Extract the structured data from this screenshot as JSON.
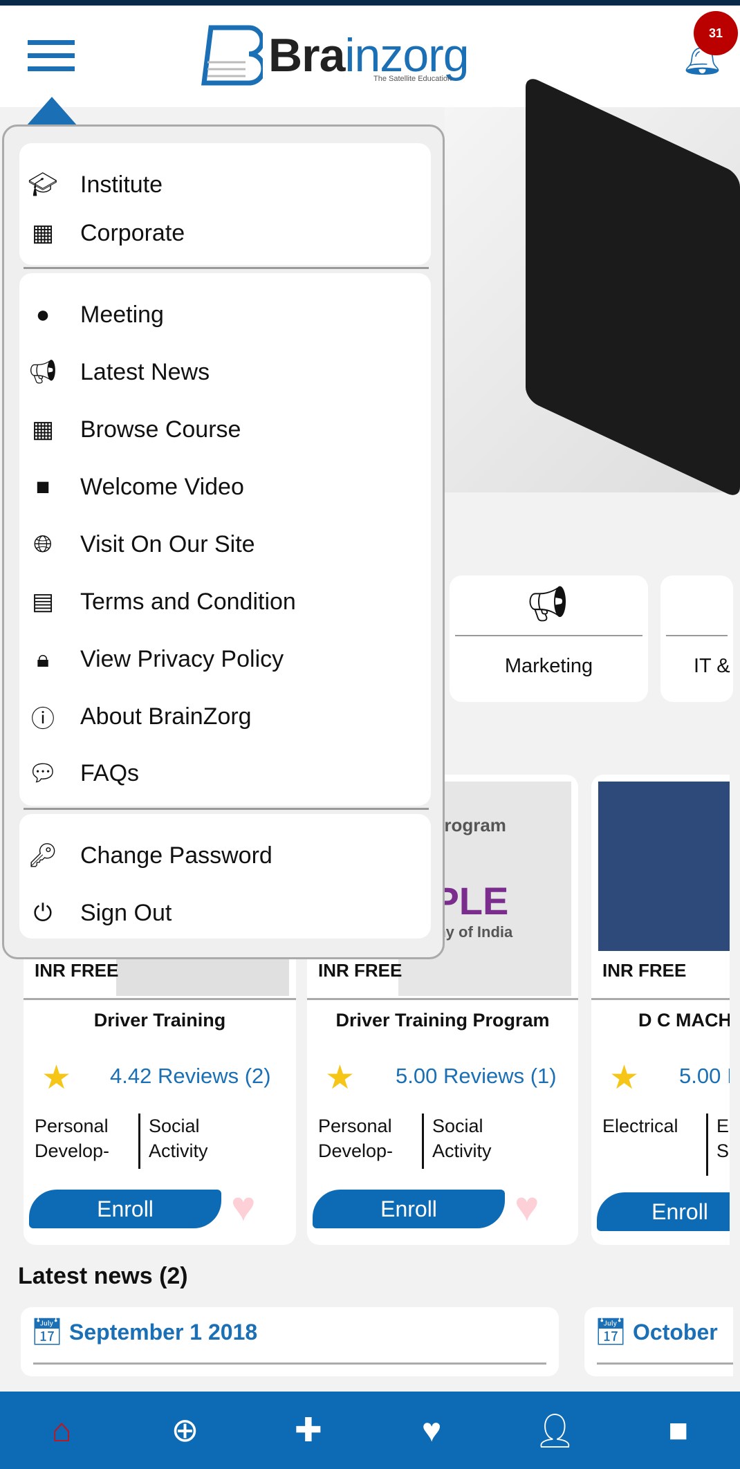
{
  "header": {
    "logo_text_a": "Bra",
    "logo_text_b": "i",
    "logo_text_c": "nzorg",
    "logo_tagline": "The Satellite Education",
    "notification_count": "31"
  },
  "menu": {
    "group1": [
      {
        "label": "Institute",
        "icon": "graduation-cap-icon"
      },
      {
        "label": "Corporate",
        "icon": "building-icon"
      }
    ],
    "group2": [
      {
        "label": "Meeting",
        "icon": "user-icon"
      },
      {
        "label": "Latest News",
        "icon": "megaphone-icon"
      },
      {
        "label": "Browse Course",
        "icon": "building-icon"
      },
      {
        "label": "Welcome Video",
        "icon": "video-camera-icon"
      },
      {
        "label": "Visit On Our Site",
        "icon": "globe-icon"
      },
      {
        "label": "Terms and Condition",
        "icon": "document-icon"
      },
      {
        "label": "View Privacy Policy",
        "icon": "lock-icon"
      },
      {
        "label": "About BrainZorg",
        "icon": "info-icon"
      },
      {
        "label": "FAQs",
        "icon": "faq-icon"
      }
    ],
    "group3": [
      {
        "label": "Change Password",
        "icon": "key-icon"
      },
      {
        "label": "Sign Out",
        "icon": "power-icon"
      }
    ]
  },
  "categories": [
    {
      "label": "Marketing"
    },
    {
      "label": "IT &"
    }
  ],
  "courses": [
    {
      "price": "INR FREE",
      "title": "Driver Training",
      "rating": "4.42 Reviews (2)",
      "tag1": "Personal Develop-",
      "tag2": "Social Activity",
      "enroll": "Enroll"
    },
    {
      "price": "INR FREE",
      "title": "Driver Training Program",
      "rating": "5.00 Reviews (1)",
      "tag1": "Personal Develop-",
      "tag2": "Social Activity",
      "enroll": "Enroll",
      "image_text_1": "ng Program",
      "image_text_2": "RPLE",
      "image_text_3": "mpany of India"
    },
    {
      "price": "INR FREE",
      "title": "D C MACH",
      "rating": "5.00 I",
      "tag1": "Electrical",
      "tag2": "Ele Se",
      "enroll": "Enroll"
    }
  ],
  "latest_news": {
    "heading": "Latest news  (2)",
    "items": [
      {
        "date": "September  1 2018"
      },
      {
        "date": "October"
      }
    ]
  },
  "bottom_nav": [
    {
      "icon": "home-icon",
      "active": true
    },
    {
      "icon": "search-plus-icon"
    },
    {
      "icon": "plus-circle-icon"
    },
    {
      "icon": "heart-icon"
    },
    {
      "icon": "user-icon"
    },
    {
      "icon": "video-icon"
    }
  ],
  "colors": {
    "primary": "#0d6ab4",
    "badge": "#b00000",
    "active_nav": "#c0161c",
    "star": "#f5c518"
  }
}
